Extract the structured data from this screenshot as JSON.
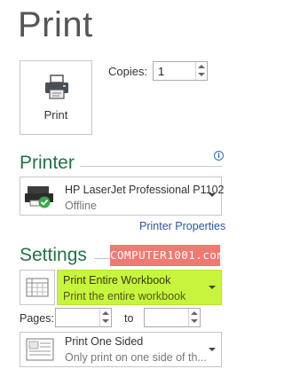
{
  "page_title": "Print",
  "print_button": {
    "label": "Print",
    "icon": "printer-icon"
  },
  "copies": {
    "label": "Copies:",
    "value": "1"
  },
  "printer_section": {
    "title": "Printer",
    "printer_name": "HP LaserJet Professional P1102",
    "printer_status": "Offline",
    "properties_link": "Printer Properties"
  },
  "settings_section": {
    "title": "Settings",
    "watermark": "COMPUTER1001.com",
    "what_to_print": {
      "title": "Print Entire Workbook",
      "subtitle": "Print the entire workbook"
    },
    "pages": {
      "label": "Pages:",
      "from_value": "",
      "to_label": "to",
      "to_value": ""
    },
    "sides": {
      "title": "Print One Sided",
      "subtitle": "Only print on one side of th..."
    }
  },
  "colors": {
    "accent": "#217346",
    "highlight": "#c7f53d",
    "link": "#2b579a",
    "watermark_bg": "#ef7a72"
  }
}
